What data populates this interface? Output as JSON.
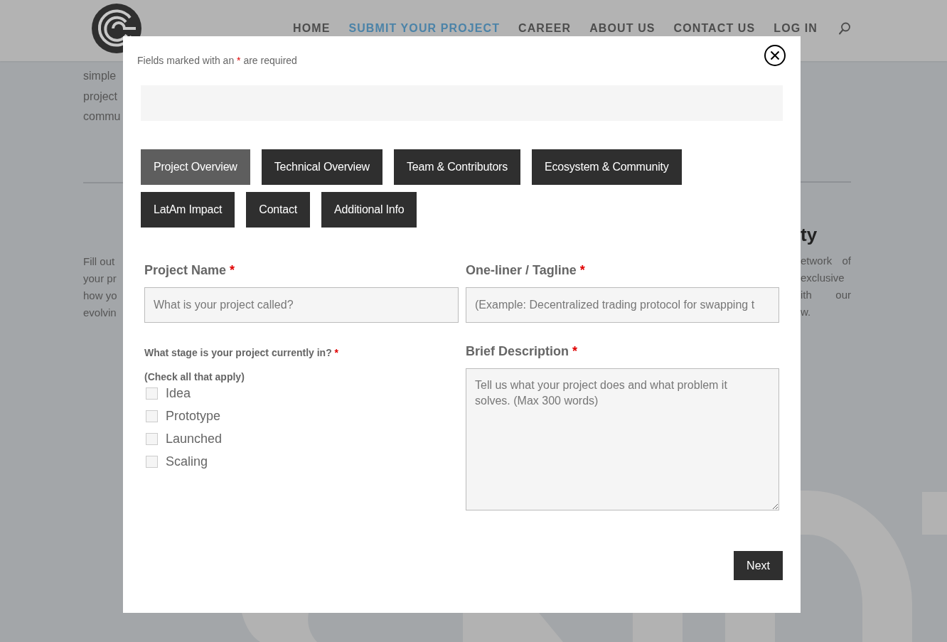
{
  "header": {
    "nav": [
      {
        "label": "HOME",
        "selected": false
      },
      {
        "label": "SUBMIT YOUR PROJECT",
        "selected": true
      },
      {
        "label": "CAREER",
        "selected": false
      },
      {
        "label": "ABOUT US",
        "selected": false
      },
      {
        "label": "CONTACT US",
        "selected": false
      },
      {
        "label": "LOG IN",
        "selected": false
      }
    ]
  },
  "background_page": {
    "left_intro_lines": [
      "simple",
      "project",
      "commu"
    ],
    "left_paragraph_lines": [
      "Fill out",
      "your pr",
      "how yo",
      "evolvin"
    ],
    "right_heading": "ty",
    "right_paragraph_lines": [
      "etwork of",
      "exclusive",
      "ith our",
      "w."
    ]
  },
  "modal": {
    "required_note": [
      {
        "text": "Fields marked with an ",
        "kind": "plain"
      },
      {
        "text": "*",
        "kind": "required"
      },
      {
        "text": " are required",
        "kind": "plain"
      }
    ],
    "tabs": [
      {
        "label": "Project Overview",
        "selected": true
      },
      {
        "label": "Technical Overview",
        "selected": false
      },
      {
        "label": "Team & Contributors",
        "selected": false
      },
      {
        "label": "Ecosystem & Community",
        "selected": false
      },
      {
        "label": "LatAm Impact",
        "selected": false
      },
      {
        "label": "Contact",
        "selected": false
      },
      {
        "label": "Additional Info",
        "selected": false
      }
    ],
    "left_column": [
      {
        "kind": "text_input",
        "label": "Project Name",
        "required_mark": "*",
        "placeholder": "What is your project called?"
      },
      {
        "kind": "checkbox_group",
        "label": "What stage is your project currently in?",
        "required_mark": "*",
        "hint": "(Check all that apply)",
        "options": [
          {
            "label": "Idea",
            "checked": false
          },
          {
            "label": "Prototype",
            "checked": false
          },
          {
            "label": "Launched",
            "checked": false
          },
          {
            "label": "Scaling",
            "checked": false
          }
        ]
      }
    ],
    "right_column": [
      {
        "kind": "text_input",
        "label": "One-liner / Tagline",
        "required_mark": "*",
        "placeholder": "(Example: Decentralized trading protocol for swapping t"
      },
      {
        "kind": "textarea",
        "label": "Brief Description",
        "required_mark": "*",
        "placeholder": "Tell us what your project does and what problem it solves. (Max 300 words)"
      }
    ],
    "next_button": "Next"
  }
}
